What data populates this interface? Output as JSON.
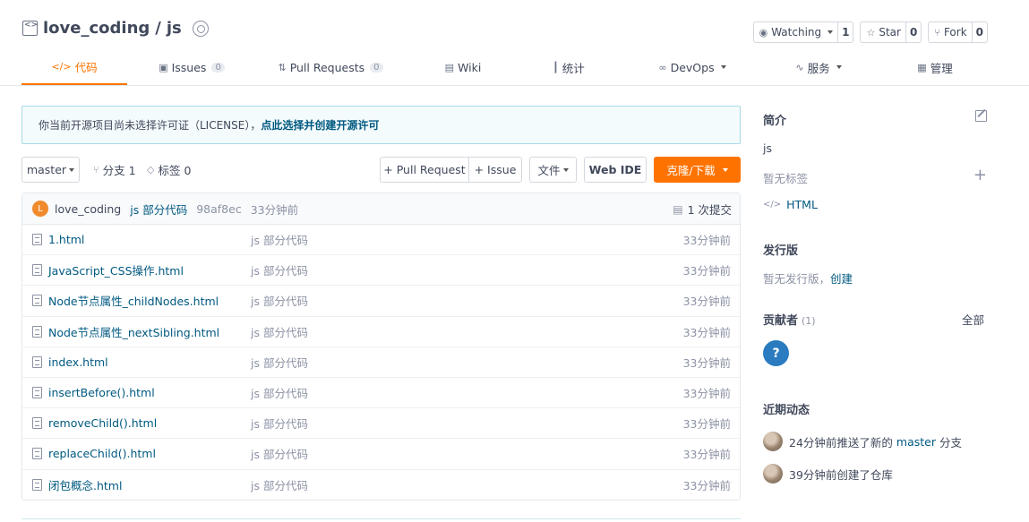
{
  "header": {
    "owner": "love_coding",
    "separator": "/",
    "repo": "js",
    "actions": [
      {
        "label": "Watching",
        "count": "1"
      },
      {
        "label": "Star",
        "count": "0"
      },
      {
        "label": "Fork",
        "count": "0"
      }
    ],
    "tabs": [
      {
        "label": "代码",
        "icon": "code-icon"
      },
      {
        "label": "Issues",
        "count": "0",
        "icon": "issue-icon"
      },
      {
        "label": "Pull Requests",
        "count": "0",
        "icon": "pull-request-icon"
      },
      {
        "label": "Wiki",
        "icon": "book-icon"
      },
      {
        "label": "统计",
        "icon": "bar-chart-icon"
      },
      {
        "label": "DevOps",
        "icon": "infinity-icon"
      },
      {
        "label": "服务",
        "icon": "pulse-icon"
      },
      {
        "label": "管理",
        "icon": "settings-doc-icon"
      }
    ]
  },
  "license": {
    "text": "你当前开源项目尚未选择许可证（LICENSE），",
    "link": "点此选择并创建开源许可"
  },
  "toolbar": {
    "branch": "master",
    "branches_label": "分支 1",
    "tags_label": "标签 0",
    "pull_request": "+ Pull Request",
    "issue": "+ Issue",
    "files": "文件",
    "web_ide": "Web IDE",
    "clone": "克隆/下载"
  },
  "commit": {
    "avatar_letter": "L",
    "author": "love_coding",
    "message": "js 部分代码",
    "sha": "98af8ec",
    "time": "33分钟前",
    "count": "1 次提交"
  },
  "files": [
    {
      "name": "1.html",
      "message": "js 部分代码",
      "time": "33分钟前"
    },
    {
      "name": "JavaScript_CSS操作.html",
      "message": "js 部分代码",
      "time": "33分钟前"
    },
    {
      "name": "Node节点属性_childNodes.html",
      "message": "js 部分代码",
      "time": "33分钟前"
    },
    {
      "name": "Node节点属性_nextSibling.html",
      "message": "js 部分代码",
      "time": "33分钟前"
    },
    {
      "name": "index.html",
      "message": "js 部分代码",
      "time": "33分钟前"
    },
    {
      "name": "insertBefore().html",
      "message": "js 部分代码",
      "time": "33分钟前"
    },
    {
      "name": "removeChild().html",
      "message": "js 部分代码",
      "time": "33分钟前"
    },
    {
      "name": "replaceChild().html",
      "message": "js 部分代码",
      "time": "33分钟前"
    },
    {
      "name": "闭包概念.html",
      "message": "js 部分代码",
      "time": "33分钟前"
    }
  ],
  "sidebar": {
    "intro_title": "简介",
    "intro_text": "js",
    "no_tags": "暂无标签",
    "language": "HTML",
    "release_title": "发行版",
    "no_release": "暂无发行版，",
    "create_link": "创建",
    "contributors_title": "贡献者",
    "contributors_count": "(1)",
    "all_link": "全部",
    "contributor_avatar": "?",
    "activity_title": "近期动态",
    "activities": [
      {
        "text": "24分钟前推送了新的",
        "link": "master",
        "suffix": "分支"
      },
      {
        "text": "39分钟前创建了仓库"
      }
    ]
  },
  "colors": {
    "accent": "#fe7300",
    "link": "#005980",
    "muted": "#8c92a4"
  }
}
